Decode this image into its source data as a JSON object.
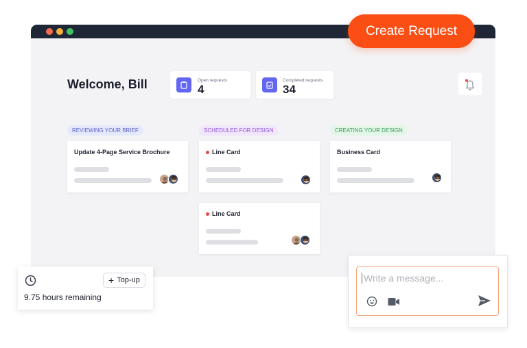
{
  "header": {
    "create_label": "Create Request",
    "window_dots": [
      "#f76b52",
      "#f7b23b",
      "#43c463"
    ]
  },
  "dashboard": {
    "welcome": "Welcome, Bill",
    "stats": [
      {
        "label": "Open requests",
        "value": "4",
        "icon": "clipboard-icon"
      },
      {
        "label": "Completed requests",
        "value": "34",
        "icon": "clipboard-check-icon"
      }
    ],
    "notification": {
      "icon": "bell-icon",
      "has_unread": true
    }
  },
  "columns": [
    {
      "status": "REVIEWING YOUR BRIEF",
      "pill_bg": "#e6e9fb",
      "pill_color": "#5a62c8",
      "cards": [
        {
          "title": "Update 4-Page Service Brochure",
          "urgent": false,
          "avatars": 2
        }
      ]
    },
    {
      "status": "SCHEDULED FOR DESIGN",
      "pill_bg": "#f1e6fb",
      "pill_color": "#9155d8",
      "cards": [
        {
          "title": "Line Card",
          "urgent": true,
          "avatars": 1
        },
        {
          "title": "Line Card",
          "urgent": true,
          "avatars": 2
        }
      ]
    },
    {
      "status": "CREATING YOUR DESIGN",
      "pill_bg": "#e3f6e8",
      "pill_color": "#3b9b58",
      "cards": [
        {
          "title": "Business Card",
          "urgent": false,
          "avatars": 1
        }
      ]
    }
  ],
  "hours_widget": {
    "topup_label": "Top-up",
    "remaining_text": "9.75 hours remaining",
    "icon": "clock-icon"
  },
  "message": {
    "placeholder": "Write a message...",
    "icons": [
      "emoji-icon",
      "video-icon",
      "send-icon"
    ]
  },
  "colors": {
    "accent": "#fb4e14",
    "stat_icon": "#6366f1",
    "urgent_dot": "#ef4444"
  }
}
